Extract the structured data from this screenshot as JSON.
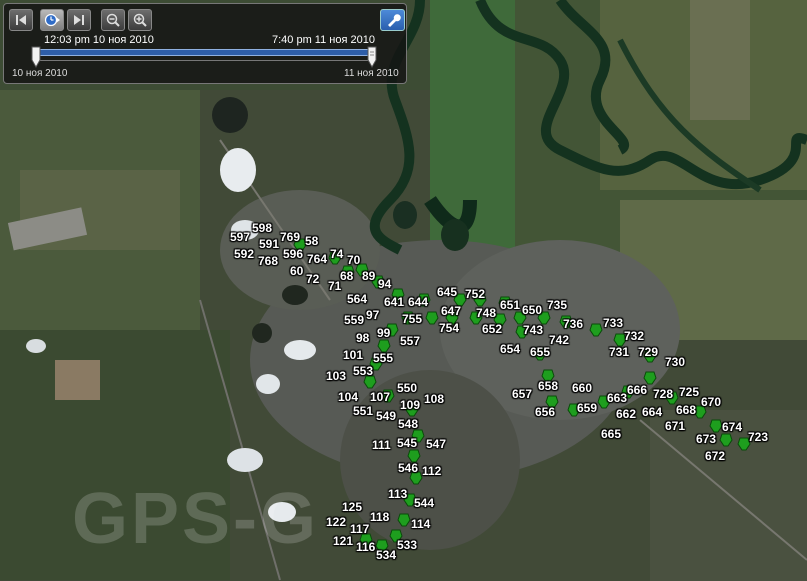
{
  "toolbar": {
    "buttons": [
      {
        "name": "skip-back-button",
        "icon": "skip-back-icon"
      },
      {
        "name": "play-button",
        "icon": "play-clock-icon"
      },
      {
        "name": "skip-forward-button",
        "icon": "skip-forward-icon"
      },
      {
        "name": "zoom-out-button",
        "icon": "zoom-out-icon"
      },
      {
        "name": "zoom-in-button",
        "icon": "zoom-in-icon"
      }
    ],
    "settings_icon": "wrench-icon"
  },
  "timeline": {
    "range_start_time": "12:03 pm 10 ноя 2010",
    "range_end_time": "7:40 pm 11 ноя 2010",
    "start_date": "10 ноя 2010",
    "end_date": "11 ноя 2010",
    "accent_color": "#2e5ea8"
  },
  "watermark": "GPS-G",
  "marker_color": "#1e9e1e",
  "markers": [
    {
      "label": "597"
    },
    {
      "label": "598"
    },
    {
      "label": "769"
    },
    {
      "label": "58"
    },
    {
      "label": "591"
    },
    {
      "label": "592"
    },
    {
      "label": "596"
    },
    {
      "label": "768"
    },
    {
      "label": "764"
    },
    {
      "label": "74"
    },
    {
      "label": "70"
    },
    {
      "label": "60"
    },
    {
      "label": "72"
    },
    {
      "label": "68"
    },
    {
      "label": "89"
    },
    {
      "label": "71"
    },
    {
      "label": "94"
    },
    {
      "label": "564"
    },
    {
      "label": "641"
    },
    {
      "label": "644"
    },
    {
      "label": "645"
    },
    {
      "label": "752"
    },
    {
      "label": "651"
    },
    {
      "label": "650"
    },
    {
      "label": "735"
    },
    {
      "label": "97"
    },
    {
      "label": "647"
    },
    {
      "label": "748"
    },
    {
      "label": "559"
    },
    {
      "label": "755"
    },
    {
      "label": "754"
    },
    {
      "label": "652"
    },
    {
      "label": "743"
    },
    {
      "label": "736"
    },
    {
      "label": "733"
    },
    {
      "label": "99"
    },
    {
      "label": "98"
    },
    {
      "label": "557"
    },
    {
      "label": "742"
    },
    {
      "label": "654"
    },
    {
      "label": "655"
    },
    {
      "label": "732"
    },
    {
      "label": "731"
    },
    {
      "label": "729"
    },
    {
      "label": "101"
    },
    {
      "label": "555"
    },
    {
      "label": "730"
    },
    {
      "label": "103"
    },
    {
      "label": "553"
    },
    {
      "label": "550"
    },
    {
      "label": "658"
    },
    {
      "label": "660"
    },
    {
      "label": "666"
    },
    {
      "label": "728"
    },
    {
      "label": "725"
    },
    {
      "label": "107"
    },
    {
      "label": "104"
    },
    {
      "label": "108"
    },
    {
      "label": "657"
    },
    {
      "label": "663"
    },
    {
      "label": "670"
    },
    {
      "label": "109"
    },
    {
      "label": "551"
    },
    {
      "label": "549"
    },
    {
      "label": "656"
    },
    {
      "label": "659"
    },
    {
      "label": "662"
    },
    {
      "label": "664"
    },
    {
      "label": "668"
    },
    {
      "label": "548"
    },
    {
      "label": "671"
    },
    {
      "label": "674"
    },
    {
      "label": "665"
    },
    {
      "label": "673"
    },
    {
      "label": "723"
    },
    {
      "label": "111"
    },
    {
      "label": "545"
    },
    {
      "label": "547"
    },
    {
      "label": "672"
    },
    {
      "label": "546"
    },
    {
      "label": "112"
    },
    {
      "label": "113"
    },
    {
      "label": "544"
    },
    {
      "label": "125"
    },
    {
      "label": "118"
    },
    {
      "label": "122"
    },
    {
      "label": "117"
    },
    {
      "label": "114"
    },
    {
      "label": "121"
    },
    {
      "label": "533"
    },
    {
      "label": "116"
    },
    {
      "label": "534"
    }
  ]
}
